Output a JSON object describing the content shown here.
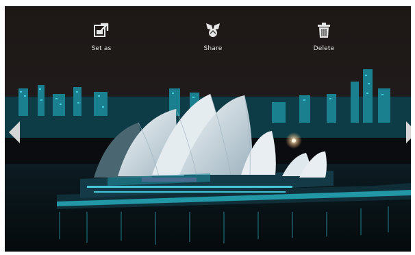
{
  "toolbar": {
    "actions": [
      {
        "label": "Set as",
        "icon": "set-as-icon"
      },
      {
        "label": "Share",
        "icon": "share-icon"
      },
      {
        "label": "Delete",
        "icon": "trash-icon"
      }
    ]
  },
  "navigation": {
    "previous_icon": "chevron-left-icon",
    "next_icon": "chevron-right-icon"
  },
  "colors": {
    "sky": "#1f1a18",
    "water": "#0b1a20",
    "city_lights": "#2fd0e0",
    "shell": "#e8eef2",
    "toolbar_text": "#e6e6e6"
  }
}
